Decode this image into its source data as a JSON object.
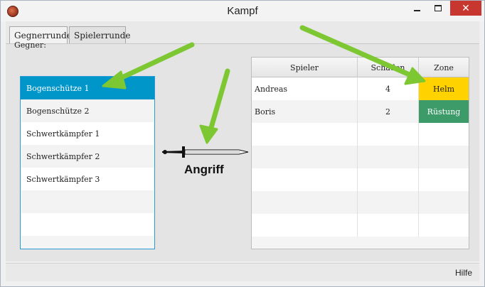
{
  "window": {
    "title": "Kampf",
    "icon": "shield-icon",
    "controls": {
      "minimize": "minimize-icon",
      "maximize": "maximize-icon",
      "close": "✕"
    }
  },
  "tabs": [
    {
      "label": "Gegnerrunde",
      "active": true
    },
    {
      "label": "Spielerrunde",
      "active": false
    }
  ],
  "enemies": {
    "label": "Gegner:",
    "items": [
      {
        "name": "Bogenschütze 1",
        "selected": true
      },
      {
        "name": "Bogenschütze 2",
        "selected": false
      },
      {
        "name": "Schwertkämpfer 1",
        "selected": false
      },
      {
        "name": "Schwertkämpfer 2",
        "selected": false
      },
      {
        "name": "Schwertkämpfer 3",
        "selected": false
      }
    ]
  },
  "attack": {
    "label": "Angriff",
    "icon": "sword-icon"
  },
  "players_table": {
    "columns": [
      "Spieler",
      "Schaden",
      "Zone"
    ],
    "rows": [
      {
        "player": "Andreas",
        "damage": "4",
        "zone": "Helm",
        "zone_color": "#ffd200"
      },
      {
        "player": "Boris",
        "damage": "2",
        "zone": "Rüstung",
        "zone_color": "#3c9b68"
      }
    ]
  },
  "statusbar": {
    "help": "Hilfe"
  },
  "colors": {
    "selection": "#0096c9",
    "annotation_arrow": "#7dc832"
  }
}
